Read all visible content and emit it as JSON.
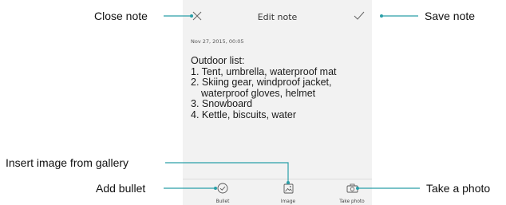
{
  "header": {
    "title": "Edit note",
    "close_icon": "close-x-icon",
    "save_icon": "checkmark-icon"
  },
  "note": {
    "date": "Nov 27, 2015, 00:05",
    "lines": [
      "Outdoor list:",
      "1. Tent, umbrella, waterproof mat",
      "2. Skiing gear, windproof jacket,",
      "waterproof gloves, helmet",
      "3. Snowboard",
      "4. Kettle, biscuits, water"
    ]
  },
  "toolbar": {
    "bullet_label": "Bullet",
    "image_label": "Image",
    "photo_label": "Take photo"
  },
  "callouts": {
    "close_note": "Close note",
    "save_note": "Save note",
    "insert_image": "Insert image from gallery",
    "add_bullet": "Add bullet",
    "take_photo": "Take a photo"
  },
  "colors": {
    "leader_line": "#2a9fa8",
    "screen_bg": "#f2f2f2"
  }
}
